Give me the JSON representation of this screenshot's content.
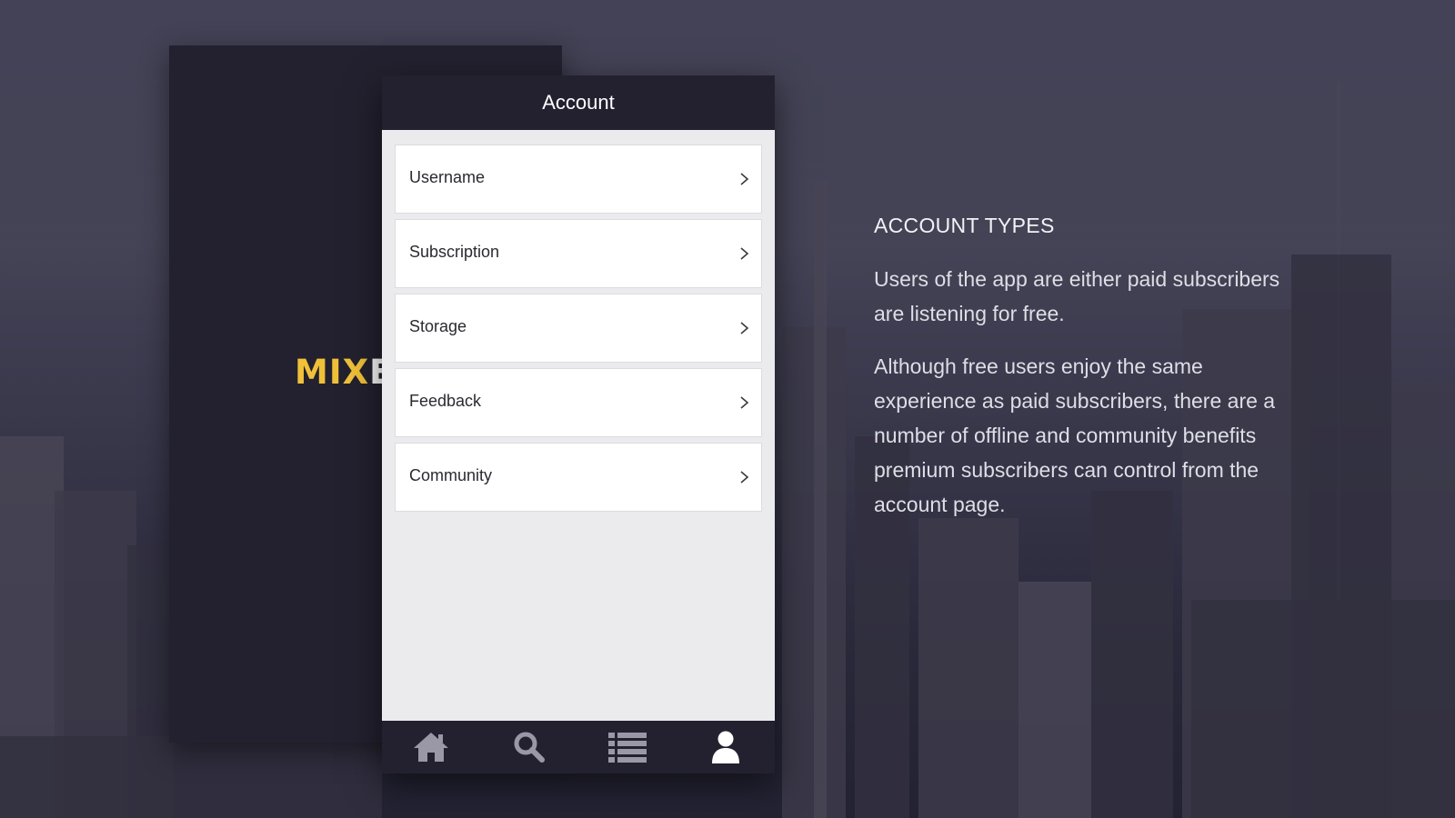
{
  "brand": {
    "logo_part1": "MIX",
    "logo_part2": "EI",
    "accent_color": "#f0c039"
  },
  "screen": {
    "title": "Account",
    "menu_items": [
      {
        "label": "Username",
        "icon": "chevron-right-icon"
      },
      {
        "label": "Subscription",
        "icon": "chevron-right-icon"
      },
      {
        "label": "Storage",
        "icon": "chevron-right-icon"
      },
      {
        "label": "Feedback",
        "icon": "chevron-right-icon"
      },
      {
        "label": "Community",
        "icon": "chevron-right-icon"
      }
    ],
    "tabbar": {
      "tabs": [
        {
          "icon": "home-icon"
        },
        {
          "icon": "search-icon"
        },
        {
          "icon": "list-icon"
        },
        {
          "icon": "user-icon",
          "active": true
        }
      ]
    }
  },
  "info": {
    "heading": "ACCOUNT TYPES",
    "paragraph1": "Users of the app are either paid subscribers are listening for free.",
    "paragraph2": "Although free users enjoy the same experience as paid subscribers, there are a number of offline and community benefits premium subscribers can control from the account page."
  },
  "colors": {
    "dark_navy": "#23212f",
    "panel_bg": "#ebebee",
    "item_bg": "#ffffff"
  }
}
